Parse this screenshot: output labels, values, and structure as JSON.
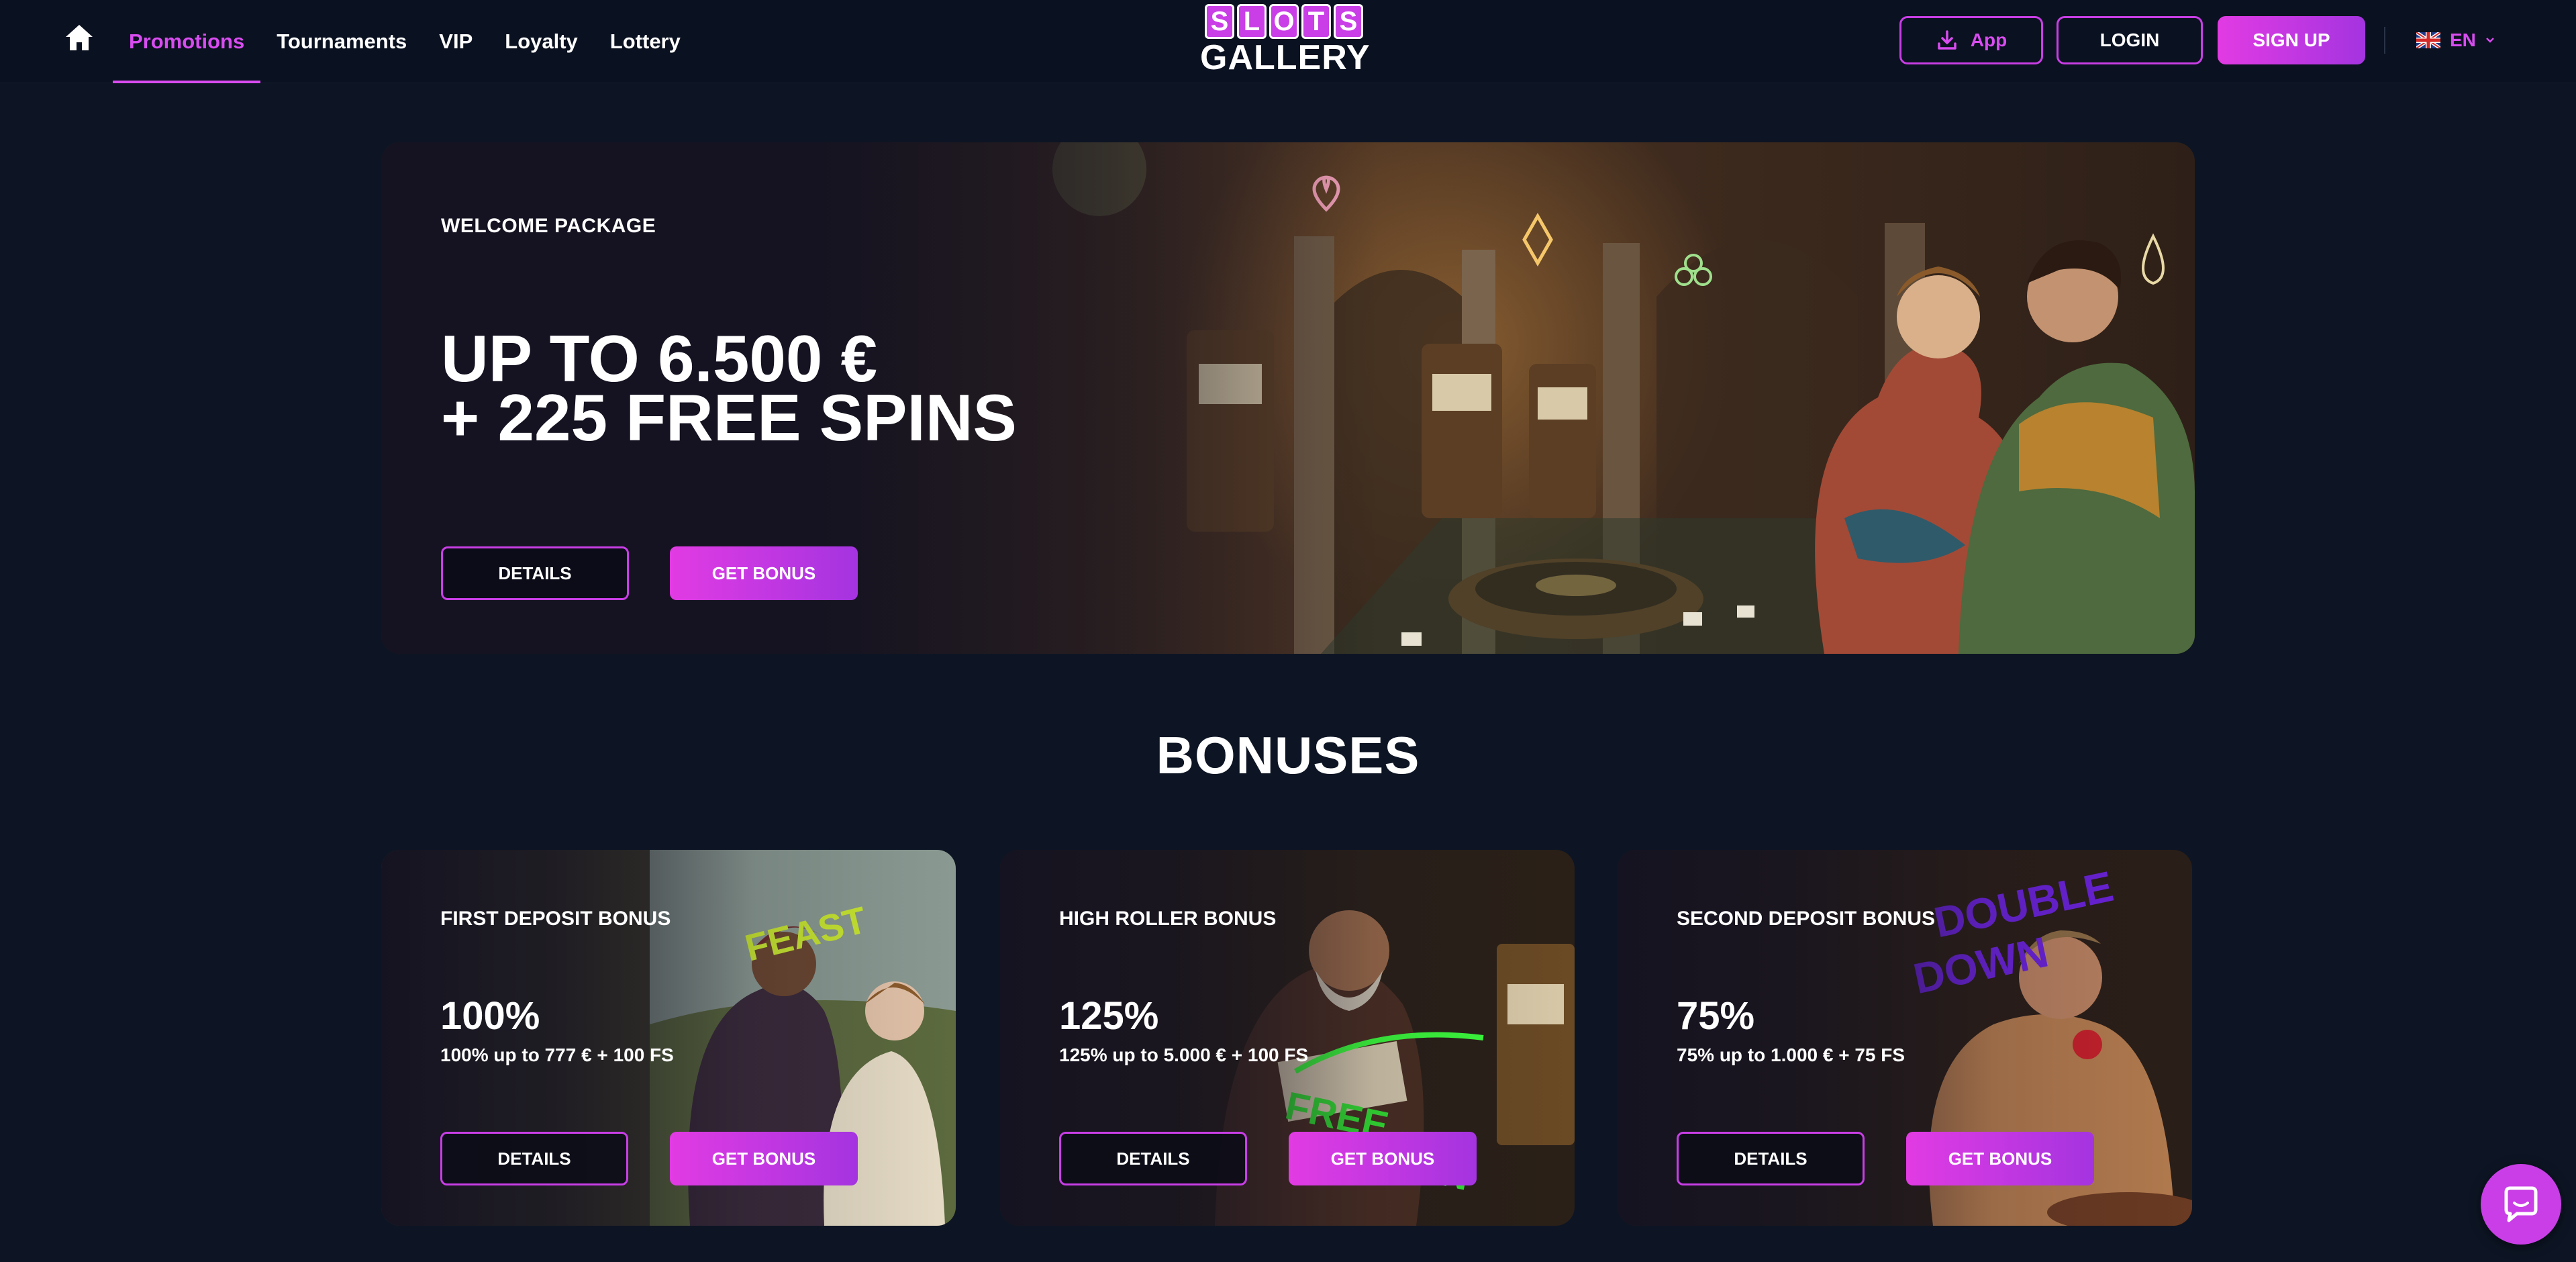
{
  "header": {
    "home_icon": "home-icon",
    "nav": [
      "Promotions",
      "Tournaments",
      "VIP",
      "Loyalty",
      "Lottery"
    ],
    "active_nav": "Promotions",
    "logo_top": [
      "S",
      "L",
      "O",
      "T",
      "S"
    ],
    "logo_bottom": "GALLERY",
    "app_label": "App",
    "login_label": "LOGIN",
    "signup_label": "SIGN UP",
    "language": "EN",
    "accent_color": "#d84cf0"
  },
  "hero": {
    "kicker": "WELCOME PACKAGE",
    "title": "UP TO 6.500 €\n+ 225 FREE SPINS",
    "details_label": "DETAILS",
    "get_bonus_label": "GET BONUS"
  },
  "bonuses": {
    "title": "BONUSES",
    "cards": [
      {
        "kicker": "FIRST DEPOSIT BONUS",
        "percent": "100%",
        "description": "100% up to 777 € + 100 FS",
        "details_label": "DETAILS",
        "get_bonus_label": "GET BONUS"
      },
      {
        "kicker": "HIGH ROLLER BONUS",
        "percent": "125%",
        "description": "125% up to 5.000 € + 100 FS",
        "details_label": "DETAILS",
        "get_bonus_label": "GET BONUS"
      },
      {
        "kicker": "SECOND DEPOSIT BONUS",
        "percent": "75%",
        "description": "75% up to 1.000 € + 75 FS",
        "details_label": "DETAILS",
        "get_bonus_label": "GET BONUS"
      }
    ]
  },
  "chat": {
    "icon": "chat-icon"
  }
}
